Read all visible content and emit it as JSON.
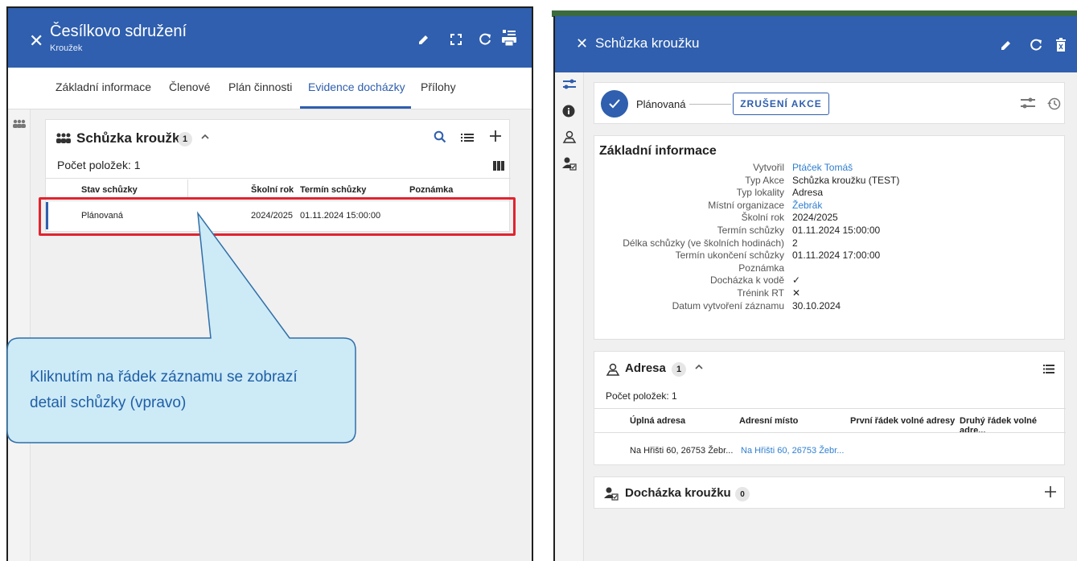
{
  "left": {
    "header": {
      "title": "Česílkovo sdružení",
      "subtitle": "Kroužek",
      "close_icon": "✕",
      "edit_icon": "✎",
      "expand_icon": "⛶",
      "refresh_icon": "↻",
      "print_icon": "🖶"
    },
    "tabs": [
      {
        "label": "Základní informace",
        "active": false
      },
      {
        "label": "Členové",
        "active": false
      },
      {
        "label": "Plán činnosti",
        "active": false
      },
      {
        "label": "Evidence docházky",
        "active": true
      },
      {
        "label": "Přílohy",
        "active": false
      }
    ],
    "rail_icon": "👥",
    "section": {
      "title": "Schůzka kroužku",
      "badge": "1",
      "chevron": "^",
      "count_label": "Počet položek: 1",
      "columns": [
        "Stav schůzky",
        "Školní rok",
        "Termín schůzky",
        "Poznámka"
      ],
      "rows": [
        {
          "stav": "Plánovaná",
          "rok": "2024/2025",
          "termin": "01.11.2024 15:00:00",
          "poznamka": ""
        }
      ]
    }
  },
  "callout": {
    "text_line1": "Kliknutím na řádek záznamu se zobrazí",
    "text_line2": "detail schůzky (vpravo)"
  },
  "right": {
    "header": {
      "title": "Schůzka kroužku",
      "close_icon": "✕"
    },
    "status": {
      "label": "Plánovaná",
      "button": "ZRUŠENÍ AKCE"
    },
    "info": {
      "title": "Základní informace",
      "rows": [
        {
          "label": "Vytvořil",
          "value": "Ptáček Tomáš",
          "link": true
        },
        {
          "label": "Typ Akce",
          "value": "Schůzka kroužku (TEST)",
          "link": false
        },
        {
          "label": "Typ lokality",
          "value": "Adresa",
          "link": false
        },
        {
          "label": "Místní organizace",
          "value": "Žebrák",
          "link": true
        },
        {
          "label": "Školní rok",
          "value": "2024/2025",
          "link": false
        },
        {
          "label": "Termín schůzky",
          "value": "01.11.2024 15:00:00",
          "link": false
        },
        {
          "label": "Délka schůzky (ve školních hodinách)",
          "value": "2",
          "link": false
        },
        {
          "label": "Termín ukončení schůzky",
          "value": "01.11.2024 17:00:00",
          "link": false
        },
        {
          "label": "Poznámka",
          "value": "",
          "link": false
        },
        {
          "label": "Docházka k vodě",
          "value": "✓",
          "link": false
        },
        {
          "label": "Trénink RT",
          "value": "✕",
          "link": false
        },
        {
          "label": "Datum vytvoření záznamu",
          "value": "30.10.2024",
          "link": false
        }
      ]
    },
    "address": {
      "title": "Adresa",
      "badge": "1",
      "count_label": "Počet položek: 1",
      "columns": [
        "Úplná adresa",
        "Adresní místo",
        "První řádek volné adresy",
        "Druhý řádek volné adre..."
      ],
      "rows": [
        {
          "full": "Na Hřišti 60, 26753 Žebr...",
          "place": "Na Hřišti 60, 26753 Žebr..."
        }
      ]
    },
    "attendance": {
      "title": "Docházka kroužku",
      "badge": "0"
    }
  },
  "colors": {
    "brand_blue": "#2f5fae",
    "highlight_red": "#e0242f",
    "callout_fill": "#cdeaf7",
    "callout_text": "#1f5fa6",
    "link": "#2f7fd0"
  }
}
